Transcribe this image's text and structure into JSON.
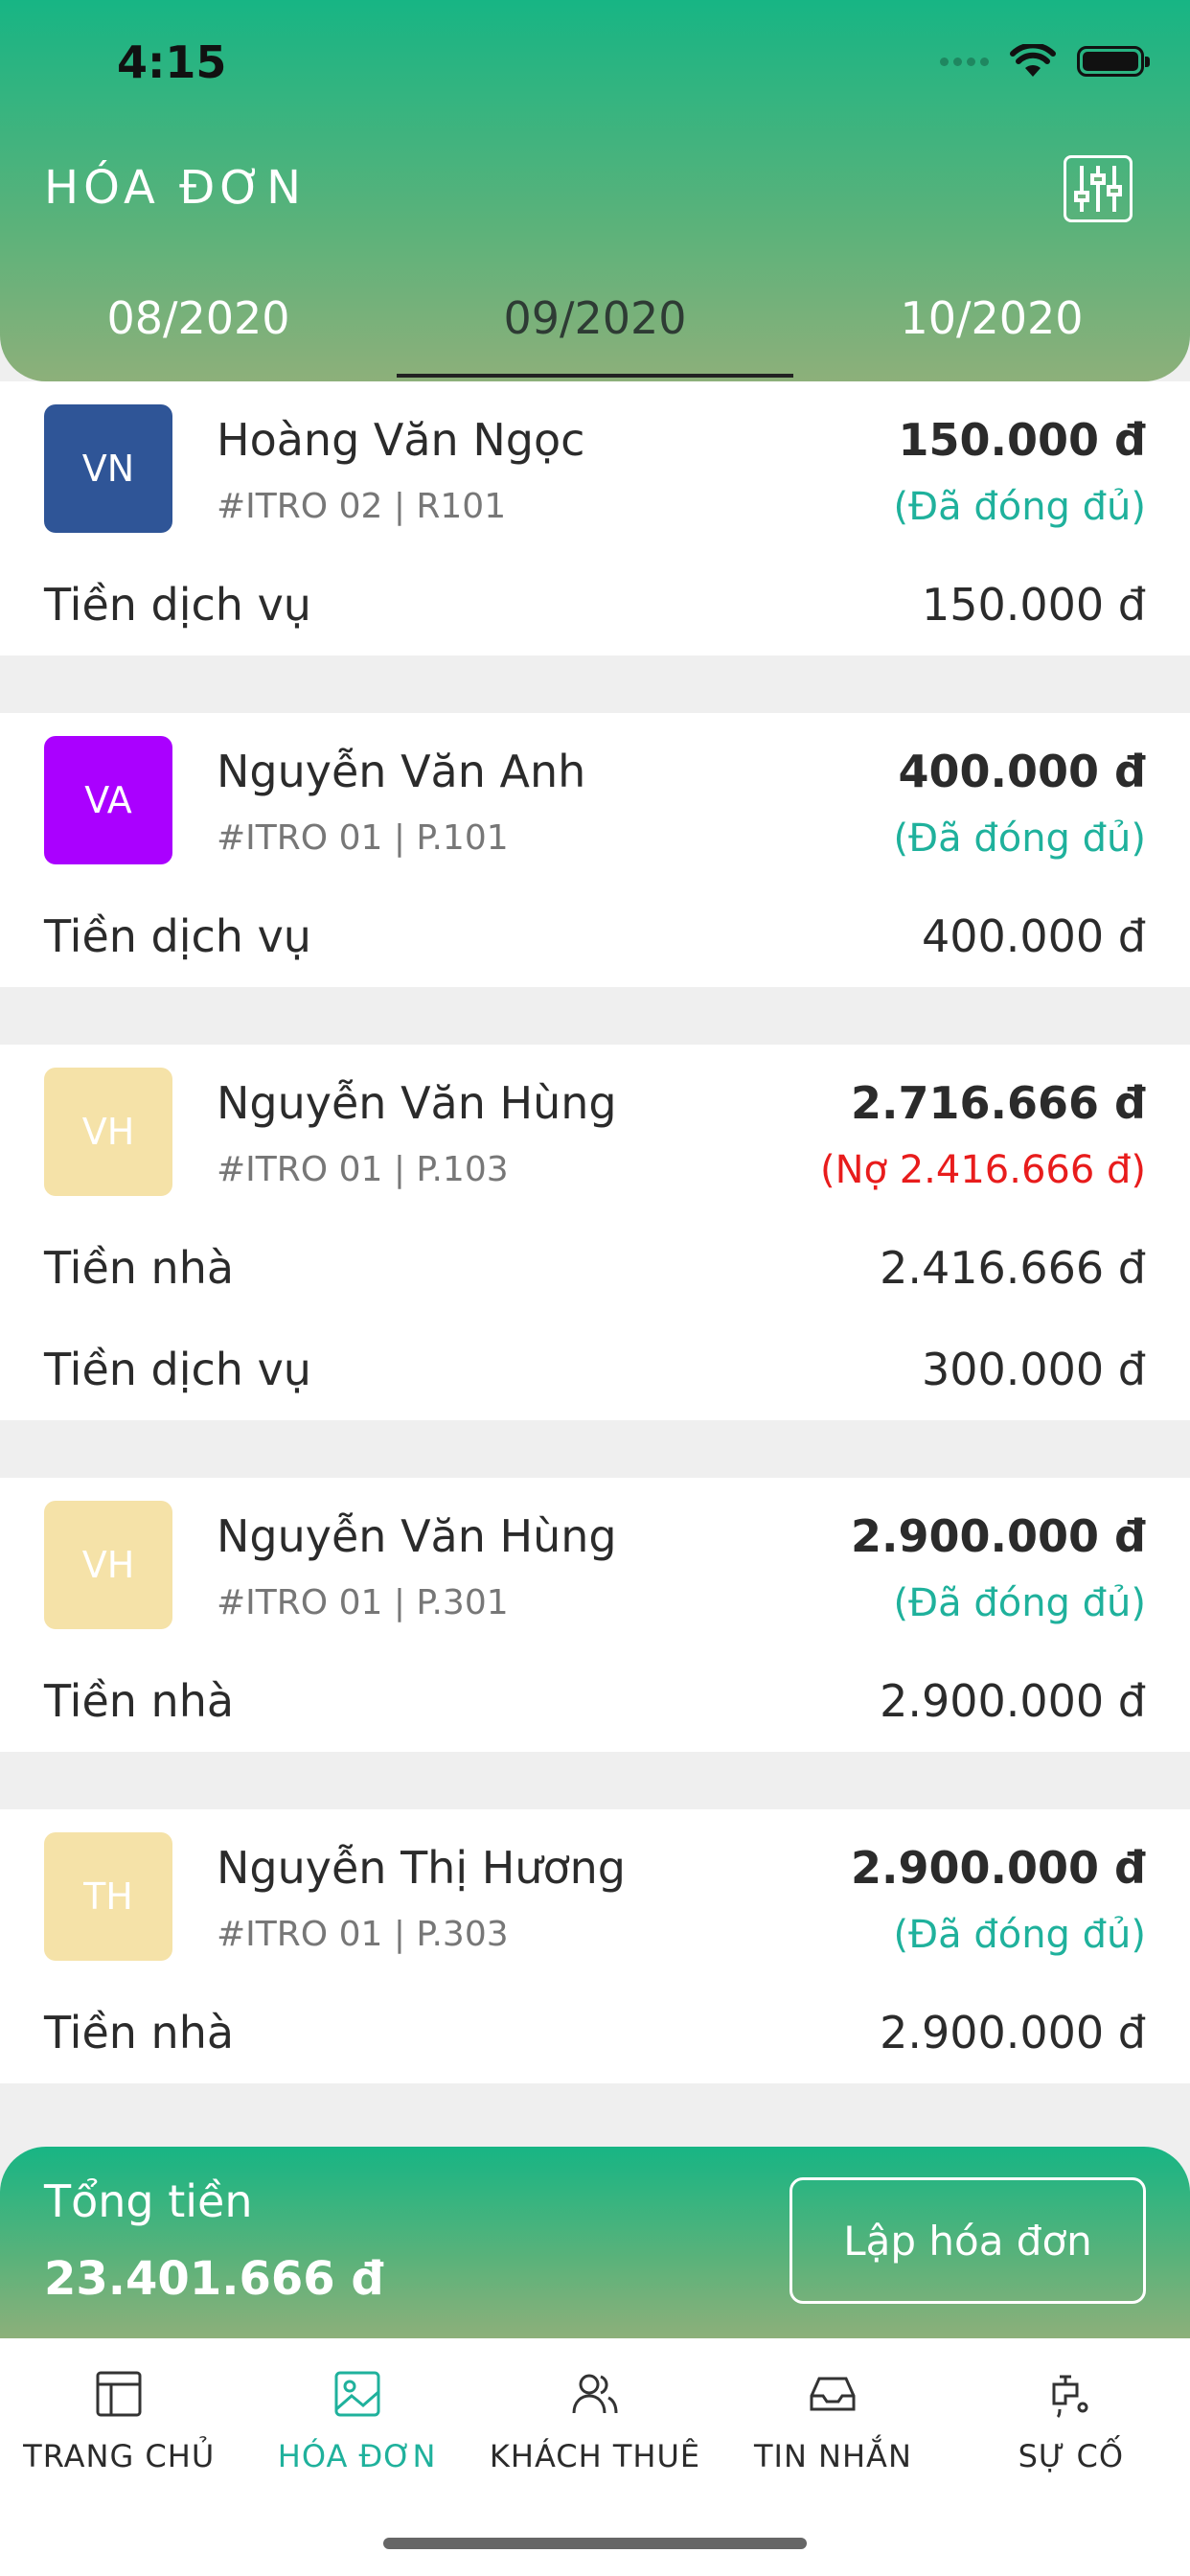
{
  "status_bar": {
    "time": "4:15"
  },
  "header": {
    "title": "HÓA ĐƠN",
    "filter_icon": "sliders-icon",
    "tabs": [
      {
        "label": "08/2020",
        "active": false
      },
      {
        "label": "09/2020",
        "active": true
      },
      {
        "label": "10/2020",
        "active": false
      }
    ]
  },
  "invoices": [
    {
      "initials": "VN",
      "avatar_color": "#2f5597",
      "name": "Hoàng Văn Ngọc",
      "code": "#ITRO 02 | R101",
      "amount": "150.000 đ",
      "status": "(Đã đóng đủ)",
      "status_type": "paid",
      "lines": [
        {
          "label": "Tiền dịch vụ",
          "value": "150.000 đ"
        }
      ]
    },
    {
      "initials": "VA",
      "avatar_color": "#aa00ff",
      "name": "Nguyễn Văn Anh",
      "code": "#ITRO 01 | P.101",
      "amount": "400.000 đ",
      "status": "(Đã đóng đủ)",
      "status_type": "paid",
      "lines": [
        {
          "label": "Tiền dịch vụ",
          "value": "400.000 đ"
        }
      ]
    },
    {
      "initials": "VH",
      "avatar_color": "#f5e2a8",
      "name": "Nguyễn Văn Hùng",
      "code": "#ITRO 01 | P.103",
      "amount": "2.716.666 đ",
      "status": "(Nợ 2.416.666 đ)",
      "status_type": "debt",
      "lines": [
        {
          "label": "Tiền nhà",
          "value": "2.416.666 đ"
        },
        {
          "label": "Tiền dịch vụ",
          "value": "300.000 đ"
        }
      ]
    },
    {
      "initials": "VH",
      "avatar_color": "#f5e2a8",
      "name": "Nguyễn Văn Hùng",
      "code": "#ITRO 01 | P.301",
      "amount": "2.900.000 đ",
      "status": "(Đã đóng đủ)",
      "status_type": "paid",
      "lines": [
        {
          "label": "Tiền nhà",
          "value": "2.900.000 đ"
        }
      ]
    },
    {
      "initials": "TH",
      "avatar_color": "#f5e2a8",
      "name": "Nguyễn Thị Hương",
      "code": "#ITRO 01 | P.303",
      "amount": "2.900.000 đ",
      "status": "(Đã đóng đủ)",
      "status_type": "paid",
      "lines": [
        {
          "label": "Tiền nhà",
          "value": "2.900.000 đ"
        }
      ]
    }
  ],
  "total": {
    "label": "Tổng tiền",
    "value": "23.401.666 đ",
    "button_label": "Lập hóa đơn"
  },
  "bottom_nav": [
    {
      "label": "TRANG CHỦ",
      "icon": "layout-icon",
      "active": false
    },
    {
      "label": "HÓA ĐƠN",
      "icon": "image-icon",
      "active": true
    },
    {
      "label": "KHÁCH THUÊ",
      "icon": "users-icon",
      "active": false
    },
    {
      "label": "TIN NHẮN",
      "icon": "inbox-icon",
      "active": false
    },
    {
      "label": "SỰ CỐ",
      "icon": "faucet-icon",
      "active": false
    }
  ],
  "colors": {
    "accent": "#17b584",
    "paid": "#1fb19c",
    "debt": "#e81c1c"
  }
}
